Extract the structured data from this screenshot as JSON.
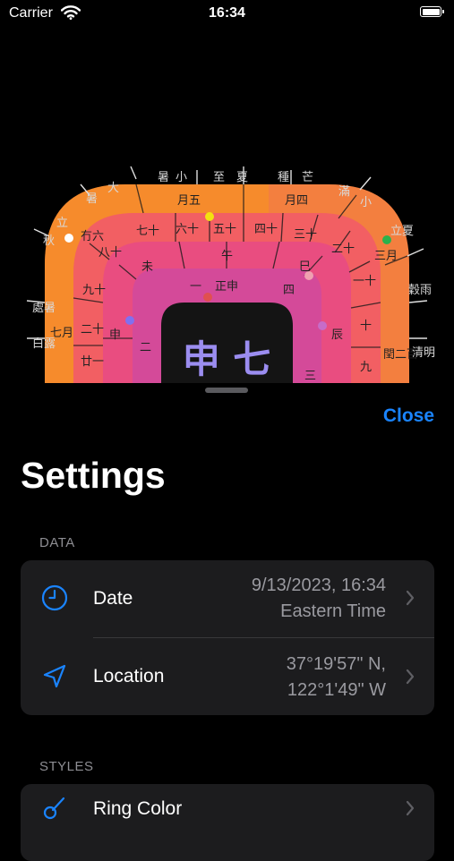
{
  "status_bar": {
    "carrier": "Carrier",
    "time": "16:34"
  },
  "dial": {
    "outer_ring_labels": [
      "七月",
      "處暑",
      "白露",
      "秋",
      "立",
      "暑",
      "大",
      "暑",
      "小",
      "至",
      "夏",
      "種",
      "芒",
      "滿",
      "小",
      "立夏",
      "穀雨",
      "清明"
    ],
    "ring1_labels": [
      "月五",
      "月四",
      "冇六",
      "三月",
      "閏二百"
    ],
    "ring2_labels": [
      "七十",
      "六十",
      "五十",
      "四十",
      "三十",
      "二十",
      "一十",
      "十",
      "九",
      "八十",
      "九十",
      "二十",
      "廿一"
    ],
    "ring3_labels": [
      "未",
      "午",
      "巳",
      "辰",
      "申"
    ],
    "ring4_labels": [
      "一",
      "正申",
      "四",
      "二",
      "三"
    ],
    "center_text": "申 七",
    "colors": {
      "ring_outer": "#f37f3f",
      "ring_1": "#f25f63",
      "ring_2": "#e94d80",
      "ring_3": "#d44a99",
      "center": "#141414",
      "center_text": "#9b8df0"
    }
  },
  "nav": {
    "close_label": "Close"
  },
  "page_title": "Settings",
  "sections": {
    "data": {
      "header": "DATA",
      "date": {
        "label": "Date",
        "value_line1": "9/13/2023, 16:34",
        "value_line2": "Eastern Time",
        "icon": "clock-icon"
      },
      "location": {
        "label": "Location",
        "value_line1": "37°19'57\" N,",
        "value_line2": "122°1'49\" W",
        "icon": "location-arrow-icon"
      }
    },
    "styles": {
      "header": "STYLES",
      "ring_color": {
        "label": "Ring Color",
        "icon": "paintbrush-icon"
      }
    }
  },
  "accent_color": "#1a84ff"
}
